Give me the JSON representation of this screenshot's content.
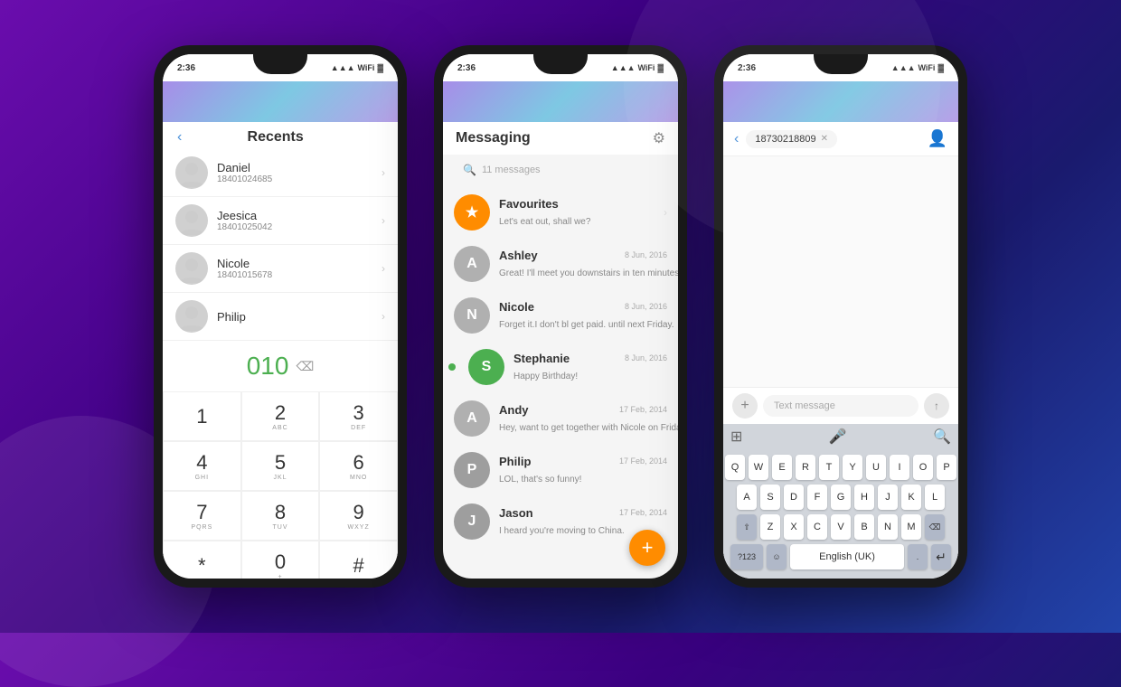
{
  "phone1": {
    "status_time": "2:36",
    "title": "Recents",
    "contacts": [
      {
        "name": "Daniel",
        "number": "18401024685"
      },
      {
        "name": "Jeesica",
        "number": "18401025042"
      },
      {
        "name": "Nicole",
        "number": "18401015678"
      },
      {
        "name": "Philip",
        "number": ""
      }
    ],
    "dialpad_number": "010",
    "keys": [
      {
        "number": "1",
        "letters": ""
      },
      {
        "number": "2",
        "letters": "ABC"
      },
      {
        "number": "3",
        "letters": "DEF"
      },
      {
        "number": "4",
        "letters": "GHI"
      },
      {
        "number": "5",
        "letters": "JKL"
      },
      {
        "number": "6",
        "letters": "MNO"
      },
      {
        "number": "7",
        "letters": "PQRS"
      },
      {
        "number": "8",
        "letters": "TUV"
      },
      {
        "number": "9",
        "letters": "WXYZ"
      },
      {
        "number": "*",
        "letters": ""
      },
      {
        "number": "0",
        "letters": "+"
      },
      {
        "number": "#",
        "letters": ""
      }
    ]
  },
  "phone2": {
    "status_time": "2:36",
    "title": "Messaging",
    "search_placeholder": "11 messages",
    "messages": [
      {
        "name": "Favourites",
        "preview": "Let's eat out, shall we?",
        "date": "",
        "avatar_letter": "★",
        "avatar_color": "orange",
        "has_chevron": true
      },
      {
        "name": "Ashley",
        "preview": "Great! I'll meet you downstairs in ten minutes. Don't forge",
        "date": "8 Jun, 2016",
        "avatar_letter": "A",
        "avatar_color": "gray"
      },
      {
        "name": "Nicole",
        "preview": "Forget it.I don't bl get paid. until next Friday.",
        "date": "8 Jun, 2016",
        "avatar_letter": "N",
        "avatar_color": "gray"
      },
      {
        "name": "Stephanie",
        "preview": "Happy Birthday!",
        "date": "8 Jun, 2016",
        "avatar_letter": "S",
        "avatar_color": "green",
        "unread": true
      },
      {
        "name": "Andy",
        "preview": "Hey, want to get together with Nicole on Friday?",
        "date": "17 Feb, 2014",
        "avatar_letter": "A",
        "avatar_color": "gray"
      },
      {
        "name": "Philip",
        "preview": "LOL, that's so funny!",
        "date": "17 Feb, 2014",
        "avatar_letter": "P",
        "avatar_color": "gray"
      },
      {
        "name": "Jason",
        "preview": "I heard you're moving to China.",
        "date": "17 Feb, 2014",
        "avatar_letter": "J",
        "avatar_color": "gray"
      }
    ],
    "fab_icon": "+"
  },
  "phone3": {
    "status_time": "2:36",
    "phone_number": "18730218809",
    "text_placeholder": "Text message",
    "keyboard": {
      "row1": [
        "Q",
        "W",
        "E",
        "R",
        "T",
        "Y",
        "U",
        "I",
        "O",
        "P"
      ],
      "row2": [
        "A",
        "S",
        "D",
        "F",
        "G",
        "H",
        "J",
        "K",
        "L"
      ],
      "row3": [
        "Z",
        "X",
        "C",
        "V",
        "B",
        "N",
        "M"
      ],
      "special_num": "?123",
      "lang": "English (UK)",
      "period": "."
    }
  }
}
